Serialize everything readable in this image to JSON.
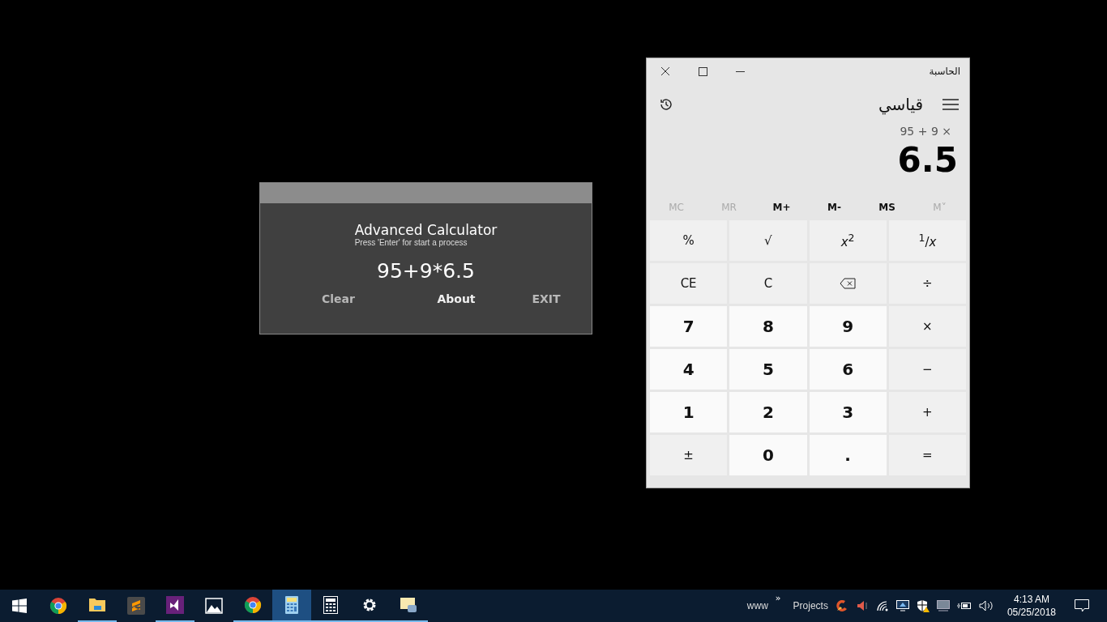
{
  "advanced_calculator": {
    "title": "Advanced Calculator",
    "hint": "Press 'Enter' for start a process",
    "expression": "95+9*6.5",
    "buttons": [
      {
        "label": "Clear",
        "kind": "dim"
      },
      {
        "label": "About",
        "kind": "bright"
      },
      {
        "label": "EXIT",
        "kind": "dim"
      }
    ]
  },
  "calculator": {
    "window_title": "الحاسبة",
    "mode": "قياسي",
    "expression": "95 + 9 ×",
    "result": "6.5",
    "memory": [
      {
        "label": "MC",
        "disabled": true
      },
      {
        "label": "MR",
        "disabled": true
      },
      {
        "label": "M+",
        "disabled": false
      },
      {
        "label": "M-",
        "disabled": false
      },
      {
        "label": "MS",
        "disabled": false
      },
      {
        "label": "M˅",
        "disabled": true
      }
    ],
    "keys": [
      {
        "label": "%",
        "kind": "op"
      },
      {
        "label": "√",
        "kind": "op"
      },
      {
        "label": "*x*$^{2}$",
        "kind": "op"
      },
      {
        "label": "$^{1}$/*x*",
        "kind": "op"
      },
      {
        "label": "CE",
        "kind": "op"
      },
      {
        "label": "C",
        "kind": "op"
      },
      {
        "kind": "backspace"
      },
      {
        "label": "÷",
        "kind": "op"
      },
      {
        "label": "7",
        "kind": "digit"
      },
      {
        "label": "8",
        "kind": "digit"
      },
      {
        "label": "9",
        "kind": "digit"
      },
      {
        "label": "×",
        "kind": "op"
      },
      {
        "label": "4",
        "kind": "digit"
      },
      {
        "label": "5",
        "kind": "digit"
      },
      {
        "label": "6",
        "kind": "digit"
      },
      {
        "label": "−",
        "kind": "op"
      },
      {
        "label": "1",
        "kind": "digit"
      },
      {
        "label": "2",
        "kind": "digit"
      },
      {
        "label": "3",
        "kind": "digit"
      },
      {
        "label": "+",
        "kind": "op"
      },
      {
        "label": "±",
        "kind": "op"
      },
      {
        "label": "0",
        "kind": "digit"
      },
      {
        "label": ".",
        "kind": "digit"
      },
      {
        "label": "=",
        "kind": "op"
      }
    ]
  },
  "taskbar": {
    "apps": [
      {
        "kind": "start",
        "selected": false,
        "running": false
      },
      {
        "kind": "chrome",
        "selected": false,
        "running": false
      },
      {
        "kind": "folder",
        "selected": false,
        "running": true
      },
      {
        "kind": "sublime",
        "selected": false,
        "running": false
      },
      {
        "kind": "visualstudio",
        "selected": false,
        "running": true
      },
      {
        "kind": "photos",
        "selected": false,
        "running": false
      },
      {
        "kind": "chrome",
        "selected": false,
        "running": true
      },
      {
        "kind": "calcapp",
        "selected": true,
        "running": true
      },
      {
        "kind": "calculator",
        "selected": false,
        "running": true
      },
      {
        "kind": "gear",
        "selected": false,
        "running": true
      },
      {
        "kind": "note",
        "selected": false,
        "running": true
      }
    ],
    "toolbars": [
      "www",
      "»",
      "Projects"
    ],
    "time": "4:13 AM",
    "date": "05/25/2018"
  }
}
